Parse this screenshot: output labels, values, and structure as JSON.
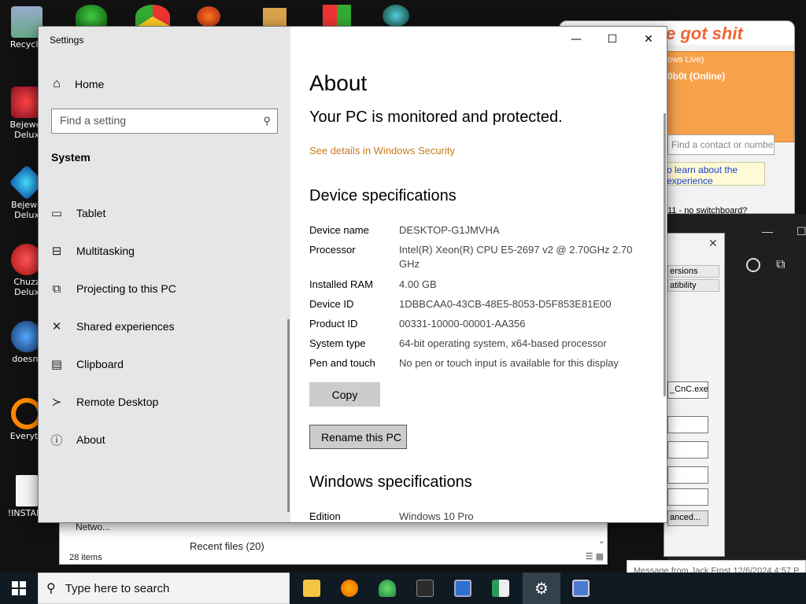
{
  "colors": {
    "accent_link": "#c87d1c",
    "sidebar_bg": "#e6e6e6",
    "button_bg": "#cccccc",
    "taskbar_bg": "#101a22",
    "chat_orange": "#f7a24a"
  },
  "desktop": {
    "icons": [
      {
        "label": "Recycle",
        "icon": "recycle-bin-icon"
      },
      {
        "label": "Bejewel Delux",
        "icon": "bejeweled-icon"
      },
      {
        "label": "Bejewe Delux",
        "icon": "bejeweled-diamond-icon"
      },
      {
        "label": "Chuzz Delux",
        "icon": "chuzzle-icon"
      },
      {
        "label": "doesnt",
        "icon": "globe-icon"
      },
      {
        "label": "Everyth",
        "icon": "everything-search-icon"
      },
      {
        "label": "!INSTALL",
        "icon": "document-icon"
      }
    ]
  },
  "chat": {
    "header_text": "e got shit",
    "title_text": "ows Live)",
    "status": "0b0t  (Online)",
    "search_placeholder": "Find a contact or number",
    "link_text": "o learn about the experience",
    "switchboard": "11 - no switchboard?"
  },
  "properties": {
    "tab1": "ersions",
    "tab2": "atibility",
    "field_exe": "_CnC.exe\"",
    "advanced": "anced..."
  },
  "explorer": {
    "network_label": "Netwo...",
    "recent_files": "Recent files (20)",
    "items_count": "28 items"
  },
  "toast": {
    "text": "Message from Jack Frost 12/6/2024 4:57 P"
  },
  "settings": {
    "window_title": "Settings",
    "home_label": "Home",
    "search_placeholder": "Find a setting",
    "section_label": "System",
    "nav": [
      {
        "label": "Tablet",
        "icon": "tablet-icon"
      },
      {
        "label": "Multitasking",
        "icon": "multitasking-icon"
      },
      {
        "label": "Projecting to this PC",
        "icon": "projecting-icon"
      },
      {
        "label": "Shared experiences",
        "icon": "shared-experiences-icon"
      },
      {
        "label": "Clipboard",
        "icon": "clipboard-icon"
      },
      {
        "label": "Remote Desktop",
        "icon": "remote-desktop-icon"
      },
      {
        "label": "About",
        "icon": "info-icon"
      }
    ],
    "main": {
      "title": "About",
      "protected_text": "Your PC is monitored and protected.",
      "security_link": "See details in Windows Security",
      "device_spec_heading": "Device specifications",
      "specs": [
        {
          "key": "Device name",
          "value": "DESKTOP-G1JMVHA"
        },
        {
          "key": "Processor",
          "value": "Intel(R) Xeon(R) CPU E5-2697 v2 @ 2.70GHz   2.70 GHz"
        },
        {
          "key": "Installed RAM",
          "value": "4.00 GB"
        },
        {
          "key": "Device ID",
          "value": "1DBBCAA0-43CB-48E5-8053-D5F853E81E00"
        },
        {
          "key": "Product ID",
          "value": "00331-10000-00001-AA356"
        },
        {
          "key": "System type",
          "value": "64-bit operating system, x64-based processor"
        },
        {
          "key": "Pen and touch",
          "value": "No pen or touch input is available for this display"
        }
      ],
      "copy_label": "Copy",
      "rename_label": "Rename this PC",
      "windows_spec_heading": "Windows specifications",
      "edition_key": "Edition",
      "edition_value": "Windows 10 Pro"
    }
  },
  "taskbar": {
    "search_placeholder": "Type here to search",
    "apps": [
      {
        "name": "file-explorer",
        "icon": "folder-icon",
        "color": "#f5c542"
      },
      {
        "name": "firefox",
        "icon": "firefox-icon",
        "color": "#e66000"
      },
      {
        "name": "messenger",
        "icon": "messenger-icon",
        "color": "#3aa83a"
      },
      {
        "name": "terminal",
        "icon": "terminal-icon",
        "color": "#2b2b2b"
      },
      {
        "name": "system-tool",
        "icon": "system-tool-icon",
        "color": "#2f6fd1"
      },
      {
        "name": "sheet-app",
        "icon": "spreadsheet-icon",
        "color": "#2a9a5a"
      },
      {
        "name": "settings",
        "icon": "gear-icon",
        "color": "#ffffff"
      },
      {
        "name": "network-tool",
        "icon": "network-tool-icon",
        "color": "#4a7bd1"
      }
    ]
  }
}
